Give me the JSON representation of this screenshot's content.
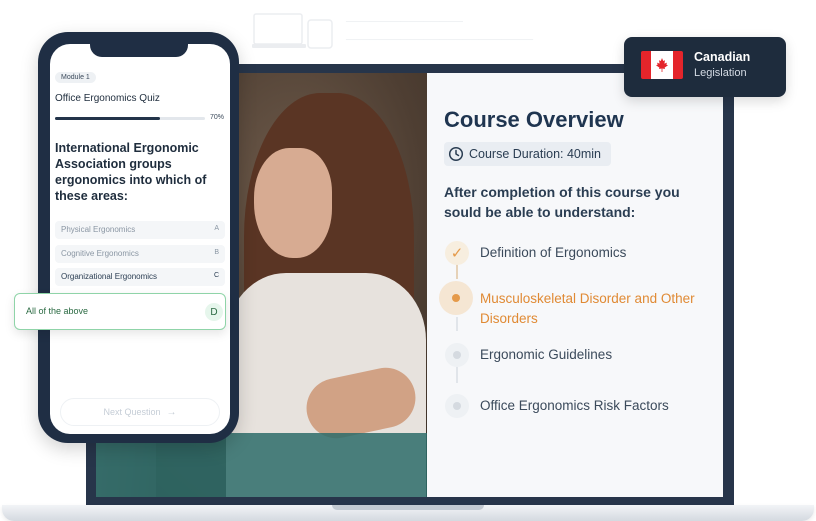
{
  "badge": {
    "title": "Canadian",
    "subtitle": "Legislation"
  },
  "overview": {
    "title": "Course Overview",
    "duration": "Course Duration: 40min",
    "subtitle": "After completion of this course you sould be able to understand:",
    "topics": [
      {
        "label": "Definition of Ergonomics",
        "status": "completed"
      },
      {
        "label": "Musculoskeletal Disorder and Other Disorders",
        "status": "current"
      },
      {
        "label": "Ergonomic Guidelines",
        "status": "upcoming"
      },
      {
        "label": "Office Ergonomics Risk Factors",
        "status": "upcoming"
      }
    ]
  },
  "quiz": {
    "module": "Module 1",
    "title": "Office Ergonomics Quiz",
    "progress_percent": 70,
    "progress_label": "70%",
    "question": "International Ergonomic Association groups ergonomics into which of these areas:",
    "options": [
      {
        "text": "Physical Ergonomics",
        "letter": "A"
      },
      {
        "text": "Cognitive Ergonomics",
        "letter": "B"
      },
      {
        "text": "Organizational Ergonomics",
        "letter": "C"
      },
      {
        "text": "All of the above",
        "letter": "D"
      }
    ],
    "next_label": "Next Question"
  },
  "colors": {
    "navy": "#1f2e44",
    "accent_orange": "#e08a34",
    "answer_green": "#8fd4a8",
    "flag_red": "#e4252b"
  },
  "icons": [
    "clock-icon",
    "check-icon",
    "maple-leaf-icon",
    "arrow-right-icon"
  ]
}
